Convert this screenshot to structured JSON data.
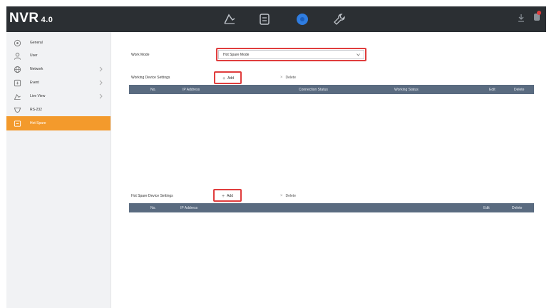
{
  "app": {
    "logo": "NVR",
    "version": "4.0"
  },
  "topnav": {
    "icons": [
      "live-view-icon",
      "playback-icon",
      "system-icon",
      "maintenance-icon"
    ],
    "right_icons": [
      "download-icon",
      "notification-icon"
    ]
  },
  "sidebar": {
    "items": [
      {
        "label": "General",
        "icon": "settings-icon"
      },
      {
        "label": "User",
        "icon": "user-icon"
      },
      {
        "label": "Network",
        "icon": "network-icon"
      },
      {
        "label": "Event",
        "icon": "event-icon"
      },
      {
        "label": "Live View",
        "icon": "camera-icon"
      },
      {
        "label": "RS-232",
        "icon": "rs232-icon"
      },
      {
        "label": "Hot Spare",
        "icon": "hot-spare-icon"
      }
    ],
    "active_index": 6
  },
  "main": {
    "work_mode_label": "Work Mode",
    "work_mode_value": "Hot Spare Mode",
    "working_section_label": "Working Device Settings",
    "add_label": "Add",
    "delete_label": "Delete",
    "working_table_headers": [
      "No.",
      "IP Address",
      "Connection Status",
      "Working Status",
      "Edit",
      "Delete"
    ],
    "hot_spare_section_label": "Hot Spare Device Settings",
    "hot_spare_table_headers": [
      "No.",
      "IP Address",
      "Edit",
      "Delete"
    ]
  },
  "colors": {
    "topbar": "#2b2f33",
    "accent": "#f39a2c",
    "table_header": "#5a6b80",
    "highlight": "#e03d3d",
    "system_icon": "#2f7de1"
  }
}
